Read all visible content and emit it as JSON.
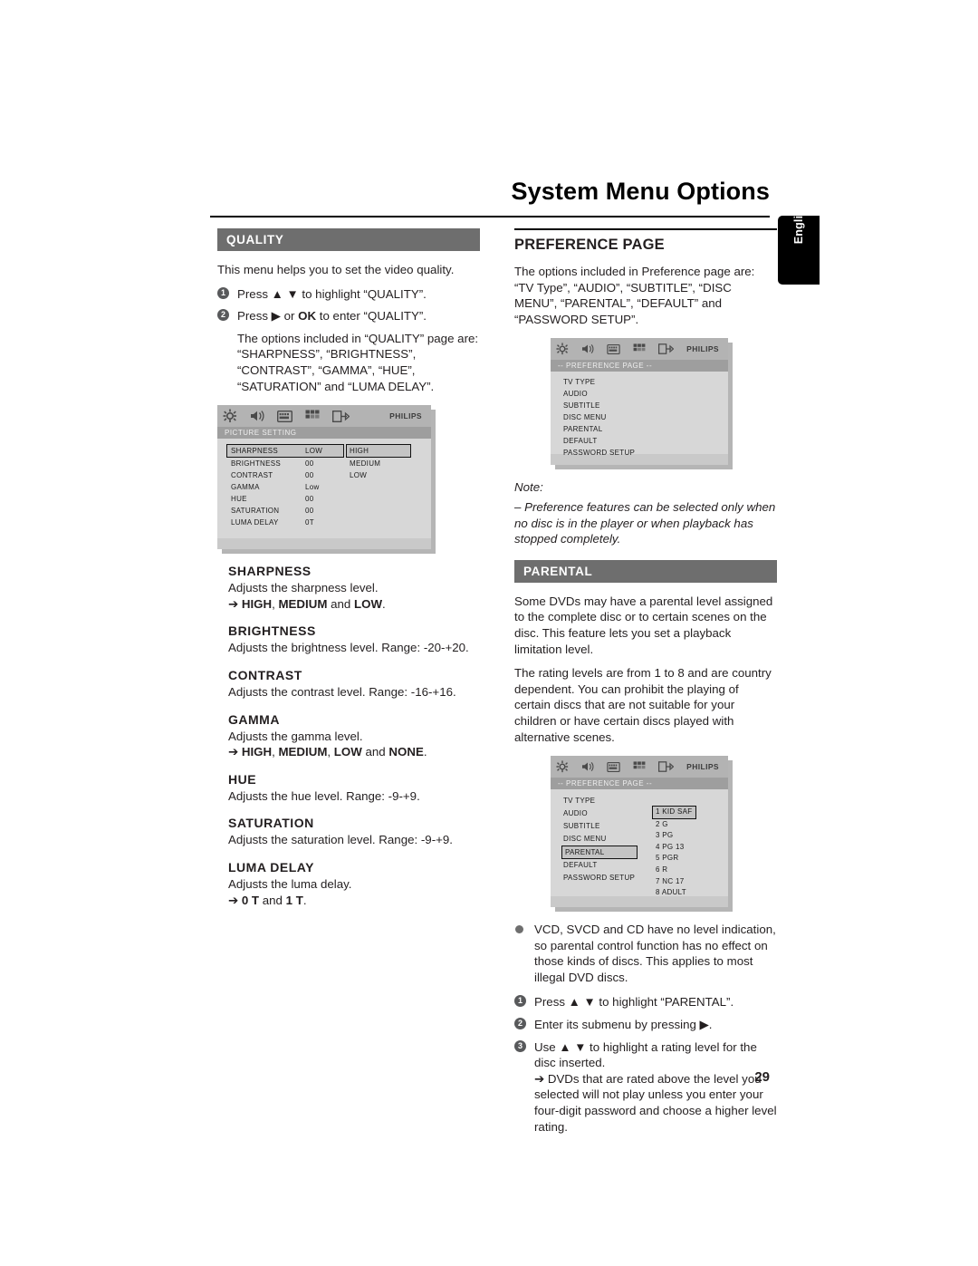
{
  "page": {
    "title": "System Menu Options",
    "language_tab": "English",
    "page_number": "29"
  },
  "left": {
    "quality": {
      "bar_label": "QUALITY",
      "intro": "This menu helps you to set the video quality.",
      "steps": [
        {
          "num": "1",
          "text": "Press ▲ ▼  to highlight “QUALITY”."
        },
        {
          "num": "2",
          "text_pre": "Press ▶ or ",
          "bold": "OK",
          "text_post": " to enter “QUALITY”."
        }
      ],
      "options_paragraph": "The options included in “QUALITY” page are: “SHARPNESS”, “BRIGHTNESS”, “CONTRAST”, “GAMMA”, “HUE”, “SATURATION” and “LUMA DELAY”."
    },
    "picture_setting_osd": {
      "brand": "PHILIPS",
      "title": "PICTURE SETTING",
      "icons": [
        "gear-icon",
        "speaker-icon",
        "display-icon",
        "grid-icon",
        "exit-icon"
      ],
      "rows": [
        {
          "label": "SHARPNESS",
          "value": "LOW",
          "selected": true
        },
        {
          "label": "BRIGHTNESS",
          "value": "00",
          "selected": false
        },
        {
          "label": "CONTRAST",
          "value": "00",
          "selected": false
        },
        {
          "label": "GAMMA",
          "value": "Low",
          "selected": false
        },
        {
          "label": "HUE",
          "value": "00",
          "selected": false
        },
        {
          "label": "SATURATION",
          "value": "00",
          "selected": false
        },
        {
          "label": "LUMA DELAY",
          "value": "0T",
          "selected": false
        }
      ],
      "submenu": [
        {
          "label": "HIGH",
          "selected": true
        },
        {
          "label": "MEDIUM",
          "selected": false
        },
        {
          "label": "LOW",
          "selected": false
        }
      ]
    },
    "definitions": [
      {
        "term": "SHARPNESS",
        "desc": "Adjusts the sharpness level.",
        "options_prefix": "➔ ",
        "options_parts": [
          {
            "text": "HIGH",
            "bold": true
          },
          {
            "text": ", ",
            "bold": false
          },
          {
            "text": "MEDIUM",
            "bold": true
          },
          {
            "text": " and ",
            "bold": false
          },
          {
            "text": "LOW",
            "bold": true
          },
          {
            "text": ".",
            "bold": false
          }
        ]
      },
      {
        "term": "BRIGHTNESS",
        "desc": "Adjusts the brightness level. Range: -20-+20.",
        "options_prefix": "",
        "options_parts": []
      },
      {
        "term": "CONTRAST",
        "desc": "Adjusts the contrast level. Range: -16-+16.",
        "options_prefix": "",
        "options_parts": []
      },
      {
        "term": "GAMMA",
        "desc": "Adjusts the gamma level.",
        "options_prefix": "➔ ",
        "options_parts": [
          {
            "text": "HIGH",
            "bold": true
          },
          {
            "text": ", ",
            "bold": false
          },
          {
            "text": "MEDIUM",
            "bold": true
          },
          {
            "text": ", ",
            "bold": false
          },
          {
            "text": "LOW",
            "bold": true
          },
          {
            "text": " and ",
            "bold": false
          },
          {
            "text": "NONE",
            "bold": true
          },
          {
            "text": ".",
            "bold": false
          }
        ]
      },
      {
        "term": "HUE",
        "desc": "Adjusts the hue level. Range: -9-+9.",
        "options_prefix": "",
        "options_parts": []
      },
      {
        "term": "SATURATION",
        "desc": "Adjusts the saturation level. Range: -9-+9.",
        "options_prefix": "",
        "options_parts": []
      },
      {
        "term": "LUMA DELAY",
        "desc": "Adjusts the luma delay.",
        "options_prefix": "➔ ",
        "options_parts": [
          {
            "text": "0 T",
            "bold": true
          },
          {
            "text": " and ",
            "bold": false
          },
          {
            "text": "1 T",
            "bold": true
          },
          {
            "text": ".",
            "bold": false
          }
        ]
      }
    ]
  },
  "right": {
    "preference": {
      "heading": "PREFERENCE PAGE",
      "intro": "The options included in Preference page are: “TV Type”, “AUDIO”, “SUBTITLE”, “DISC MENU”, “PARENTAL”,  “DEFAULT” and “PASSWORD SETUP”."
    },
    "preference_osd": {
      "brand": "PHILIPS",
      "title": "-- PREFERENCE PAGE --",
      "items": [
        "TV TYPE",
        "AUDIO",
        "SUBTITLE",
        "DISC MENU",
        "PARENTAL",
        "DEFAULT",
        "PASSWORD SETUP"
      ]
    },
    "note": {
      "label": "Note:",
      "text": "–   Preference features can be selected only when no disc is in the player or when playback has stopped completely."
    },
    "parental": {
      "bar_label": "PARENTAL",
      "paragraph1": "Some DVDs may have a parental level assigned to the complete disc or to certain scenes on the disc. This feature lets you set a playback limitation level.",
      "paragraph2": "The rating levels are from 1 to 8 and are country dependent. You can prohibit the playing of certain discs that are not suitable for your children or have certain discs played with alternative scenes."
    },
    "parental_osd": {
      "brand": "PHILIPS",
      "title": "-- PREFERENCE PAGE --",
      "items": [
        {
          "label": "TV TYPE",
          "selected": false
        },
        {
          "label": "AUDIO",
          "selected": false
        },
        {
          "label": "SUBTITLE",
          "selected": false
        },
        {
          "label": "DISC MENU",
          "selected": false
        },
        {
          "label": "PARENTAL",
          "selected": true
        },
        {
          "label": "DEFAULT",
          "selected": false
        },
        {
          "label": "PASSWORD SETUP",
          "selected": false
        }
      ],
      "ratings": [
        {
          "label": "1 KID SAF",
          "selected": true
        },
        {
          "label": "2 G",
          "selected": false
        },
        {
          "label": "3 PG",
          "selected": false
        },
        {
          "label": "4 PG 13",
          "selected": false
        },
        {
          "label": "5 PGR",
          "selected": false
        },
        {
          "label": "6 R",
          "selected": false
        },
        {
          "label": "7 NC 17",
          "selected": false
        },
        {
          "label": "8 ADULT",
          "selected": false
        }
      ]
    },
    "bullet_note": "VCD, SVCD and CD have no level indication, so parental control function has no effect on those kinds of discs. This applies to most illegal DVD discs.",
    "steps": [
      {
        "num": "1",
        "text": "Press ▲ ▼ to highlight “PARENTAL”."
      },
      {
        "num": "2",
        "text": "Enter its submenu by pressing ▶."
      },
      {
        "num": "3",
        "text": "Use ▲ ▼ to highlight a rating level for the disc inserted."
      }
    ],
    "final_arrow": "➔ DVDs that are rated above the level you selected will not play unless you enter your four-digit password and choose a higher level rating."
  }
}
